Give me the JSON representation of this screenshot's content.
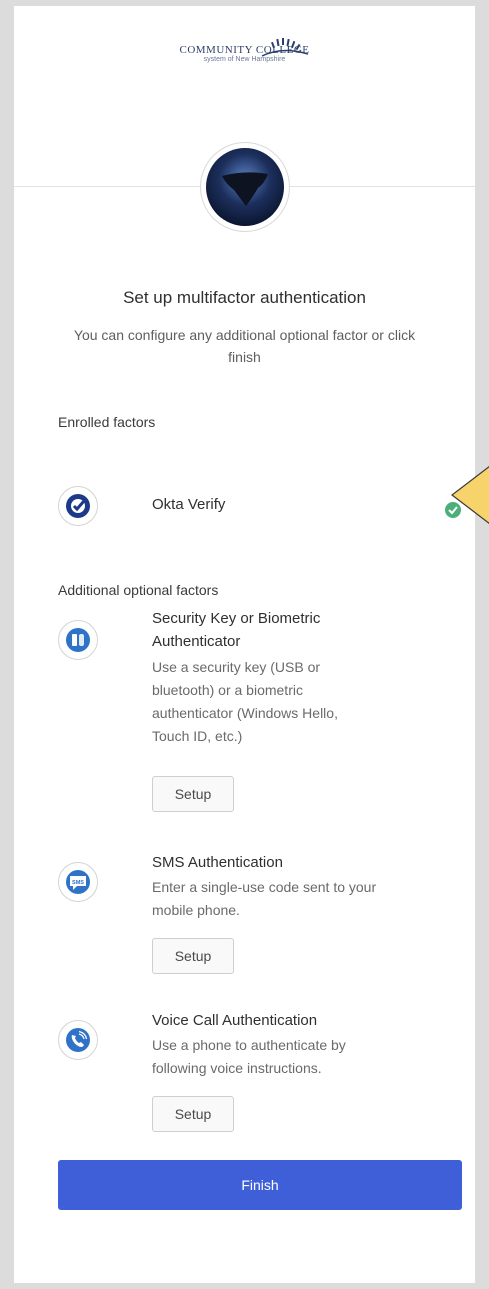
{
  "branding": {
    "org_name": "COMMUNITY COLLEGE",
    "org_sub": "system of New Hampshire"
  },
  "header": {
    "title": "Set up multifactor authentication",
    "subtitle": "You can configure any additional optional factor or click finish"
  },
  "enrolled": {
    "label": "Enrolled factors",
    "factors": [
      {
        "name": "Okta Verify",
        "icon": "okta-verify-icon",
        "status": "enrolled",
        "status_icon": "check-circle-icon"
      }
    ]
  },
  "optional": {
    "label": "Additional optional factors",
    "factors": [
      {
        "name_line1": "Security Key or Biometric",
        "name_line2": "Authenticator",
        "desc_line1": "Use a security key (USB or",
        "desc_line2": "bluetooth) or a biometric",
        "desc_line3": "authenticator (Windows Hello,",
        "desc_line4": "Touch ID, etc.)",
        "icon": "security-key-icon",
        "button": "Setup"
      },
      {
        "name_line1": "SMS Authentication",
        "desc_line1": "Enter a single-use code sent to your",
        "desc_line2": "mobile phone.",
        "icon": "sms-icon",
        "icon_text": "SMS",
        "button": "Setup"
      },
      {
        "name_line1": "Voice Call Authentication",
        "desc_line1": "Use a phone to authenticate by",
        "desc_line2": "following voice instructions.",
        "icon": "voice-call-icon",
        "button": "Setup"
      }
    ]
  },
  "actions": {
    "finish": "Finish"
  },
  "colors": {
    "accent": "#3f5fd9",
    "success": "#4caf7a",
    "factor_icon": "#2f73c9",
    "pointer": "#f6d36b"
  }
}
